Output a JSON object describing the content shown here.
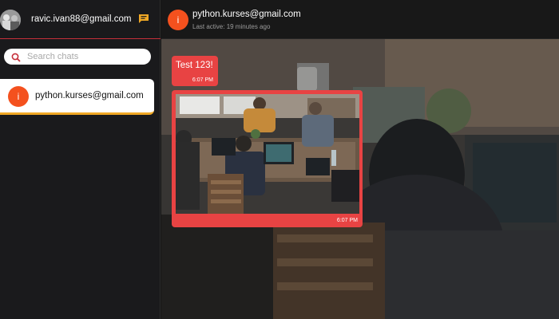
{
  "sidebar": {
    "account_email": "ravic.ivan88@gmail.com",
    "chat_icon": "chat-bubble-icon",
    "search": {
      "placeholder": "Search chats",
      "value": ""
    },
    "contacts": [
      {
        "initial": "i",
        "email": "python.kurses@gmail.com",
        "selected": true
      }
    ]
  },
  "chat": {
    "header": {
      "initial": "i",
      "name": "python.kurses@gmail.com",
      "status": "Last active: 19 minutes ago"
    },
    "messages": [
      {
        "type": "text",
        "text": "Test 123!",
        "time": "6:07 PM"
      },
      {
        "type": "image",
        "time": "6:07 PM"
      }
    ]
  },
  "colors": {
    "accent_red": "#e84343",
    "avatar_orange": "#f4511e",
    "selection_underline": "#f0a825",
    "header_divider": "#c62f3a"
  }
}
